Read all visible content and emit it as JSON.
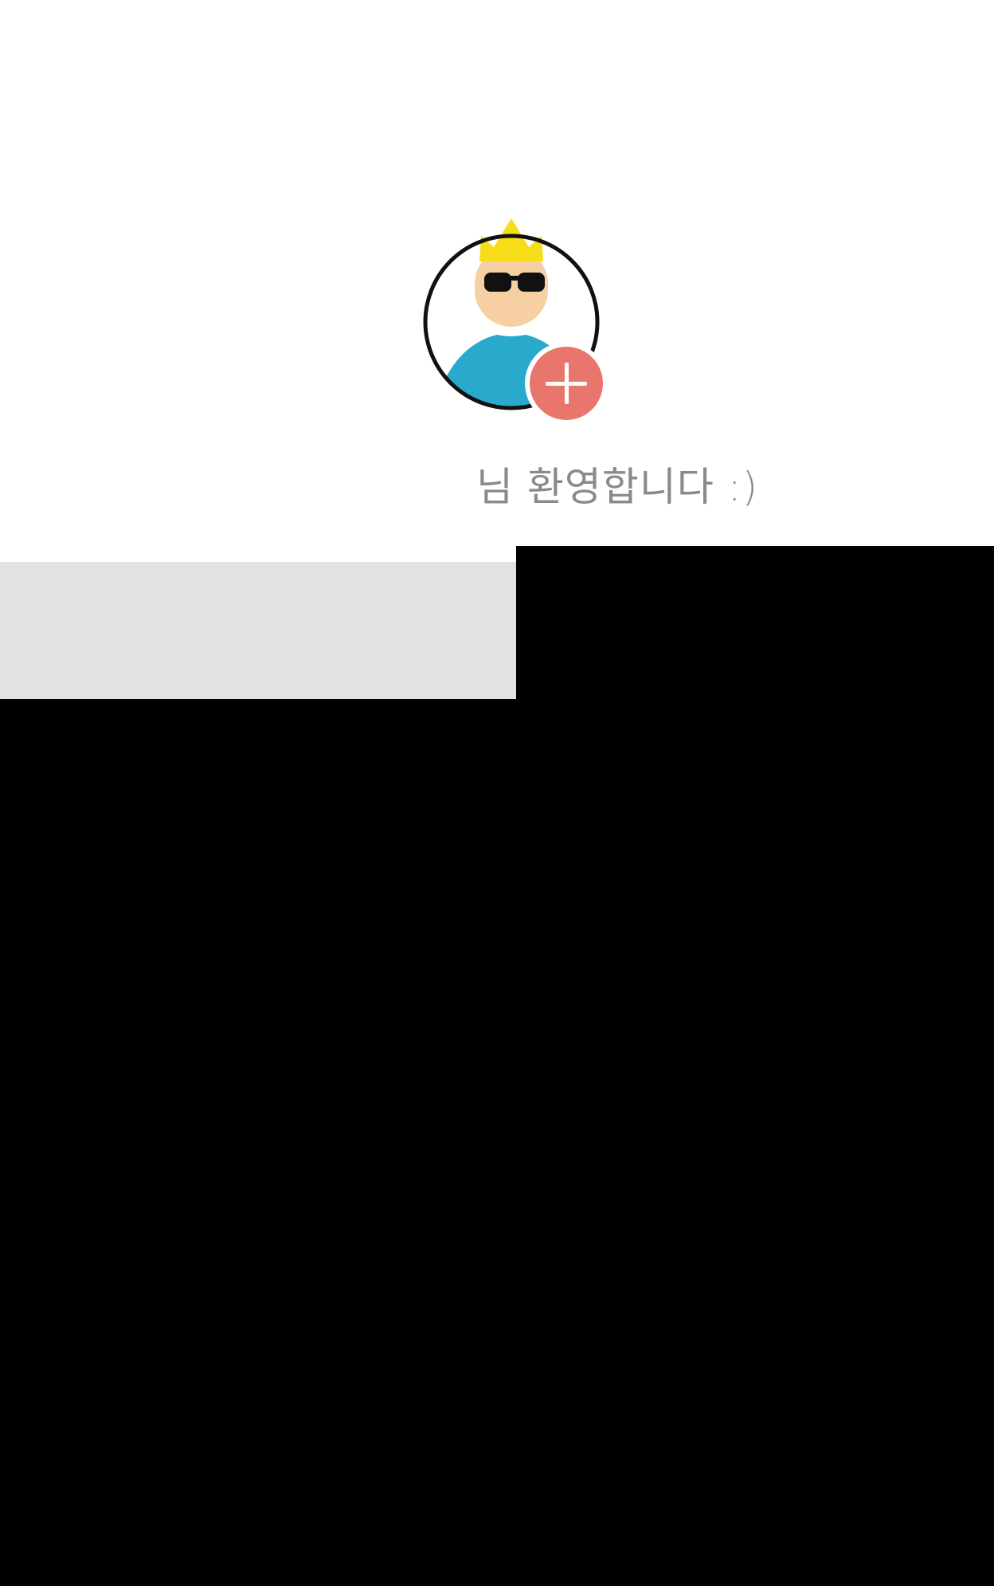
{
  "welcome": {
    "username": "",
    "suffix": "님 환영합니다 :)"
  },
  "avatar": {
    "icon": "profile-avatar-crowned-man-sunglasses",
    "badge_icon": "plus-icon",
    "colors": {
      "crown": "#f7dc1a",
      "face": "#f6cfa3",
      "glasses": "#111111",
      "shirt": "#29a9cc",
      "badge": "#e8766d",
      "ring": "#111111"
    }
  },
  "theme": {
    "header_bg": "#ffffff",
    "panel_gray": "#e2e2e2",
    "dark_bg": "#000000",
    "text_gray": "#8a8a8a"
  }
}
